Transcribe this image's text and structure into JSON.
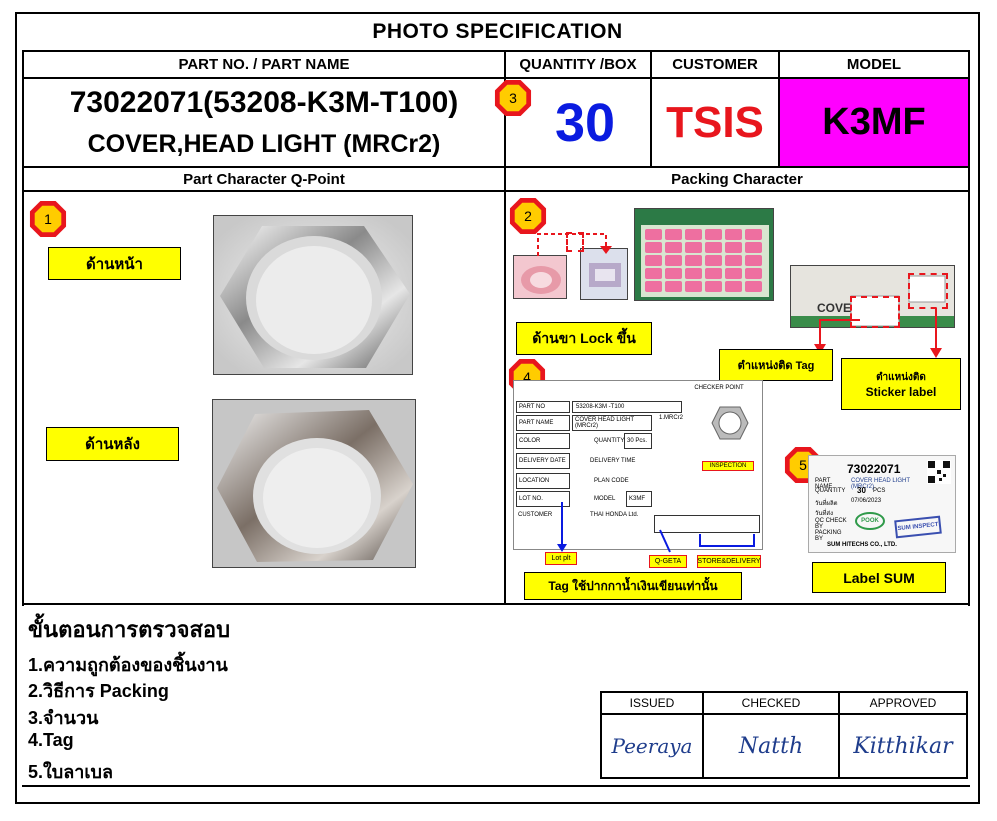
{
  "title": "PHOTO  SPECIFICATION",
  "headers": {
    "part": "PART NO. / PART NAME",
    "quantity": "QUANTITY /BOX",
    "customer": "CUSTOMER",
    "model": "MODEL"
  },
  "part_no": "73022071(53208-K3M-T100)",
  "part_name": "COVER,HEAD LIGHT (MRCr2)",
  "quantity": "30",
  "customer": "TSIS",
  "model": "K3MF",
  "sections": {
    "part_character": "Part Character Q-Point",
    "packing_character": "Packing Character"
  },
  "badges": [
    "1",
    "2",
    "3",
    "4",
    "5"
  ],
  "part_labels": {
    "front": "ด้านหน้า",
    "back": "ด้านหลัง"
  },
  "packing_labels": {
    "lock": "ด้านขา Lock ขึ้น",
    "tag_position": "ตำแหน่งติด Tag",
    "sticker_position_1": "ตำแหน่งติด",
    "sticker_position_2": "Sticker label",
    "tag_pen": "Tag ใช้ปากกาน้ำเงินเขียนเท่านั้น",
    "label_sum": "Label SUM",
    "lot_plt": "Lot plt",
    "q_geta": "Q-GETA",
    "store_delivery": "STORE&DELIVERY"
  },
  "checker_form": {
    "heading": "CHECKER POINT",
    "part_no_label": "PART NO",
    "part_no": "53208-K3M -T100",
    "part_name_label": "PART NAME",
    "part_name": "COVER HEAD LIGHT (MRCr2)",
    "color_label": "COLOR",
    "quantity_label": "QUANTITY",
    "quantity": "30 Pcs.",
    "delivery_date_label": "DELIVERY DATE",
    "delivery_time_label": "DELIVERY TIME",
    "location_label": "LOCATION",
    "plan_code_label": "PLAN CODE",
    "lot_no_label": "LOT NO.",
    "model_label": "MODEL",
    "model": "K3MF",
    "customer_label": "CUSTOMER",
    "customer": "THAI HONDA Ltd.",
    "inspection": "INSPECTION",
    "item": "1.MRCr2"
  },
  "sum_label": {
    "part_no": "73022071",
    "brand": "SUM HITECHS CO., LTD.",
    "rows": [
      "PART NAME",
      "QUANTITY",
      "วันที่ผลิต",
      "วันที่ส่ง",
      "QC CHECK BY",
      "PACKING BY"
    ],
    "name_value": "COVER HEAD LIGHT (MRCr2)",
    "qty_value": "30",
    "qty_unit": "PCS",
    "date_value": "07/06/2023",
    "stamp_qc": "POOK",
    "stamp_pack": "SUM INSPECT"
  },
  "process": {
    "title": "ขั้นตอนการตรวจสอบ",
    "items": [
      "1.ความถูกต้องของชิ้นงาน",
      "2.วิธีการ Packing",
      "3.จำนวน",
      "4.Tag",
      "5.ใบลาเบล"
    ]
  },
  "signatures": {
    "issued_label": "ISSUED",
    "checked_label": "CHECKED",
    "approved_label": "APPROVED",
    "issued": "Peeraya",
    "checked": "Natth",
    "approved": "Kitthikar"
  },
  "colors": {
    "quantity": "#0a1be0",
    "customer": "#e8161d",
    "model_bg": "#ff00ff",
    "label_bg": "#ffff00",
    "badge": "#e8161d",
    "badge_fill": "#ffcc00",
    "callout": "#e8161d"
  }
}
